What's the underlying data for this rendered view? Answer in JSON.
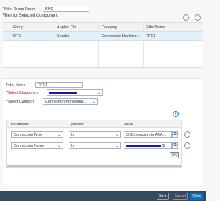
{
  "filter_group": {
    "label": "*Filter Group Name",
    "value": "RFC"
  },
  "section_title": "Filter for Selected Component",
  "toolbar": {
    "add_icon": "plus-circle-icon",
    "remove_icon": "minus-circle-icon"
  },
  "table": {
    "columns": [
      "Group",
      "Applied On",
      "Category",
      "Filter Name"
    ],
    "rows": [
      {
        "group": "RFC",
        "applied_on": "Sender",
        "category": "Connection Monitorin...",
        "filter_name": "RFC1"
      }
    ]
  },
  "form": {
    "filter_name": {
      "label": "Filter Name",
      "value": "RFC1"
    },
    "component": {
      "label": "*Select Component"
    },
    "category": {
      "label": "*Select Category",
      "value": "Connection Monitoring..."
    }
  },
  "param_table": {
    "columns": [
      "Parameter",
      "Operator",
      "Value"
    ],
    "rows": [
      {
        "parameter": "Connection Type",
        "operator": "Is",
        "value": "3 (Connection to ABA..."
      },
      {
        "parameter": "Connection Name",
        "operator": "Is",
        "value_suffix": "3)"
      }
    ],
    "ok_label": "OK"
  },
  "footer": {
    "save": "Save",
    "cancel": "Cancel",
    "close": "Close"
  },
  "colors": {
    "footer_bg": "#354a5f",
    "selected_row": "#e5f0fa",
    "accent": "#0a6ed1",
    "redaction": "#1a1aa6"
  }
}
